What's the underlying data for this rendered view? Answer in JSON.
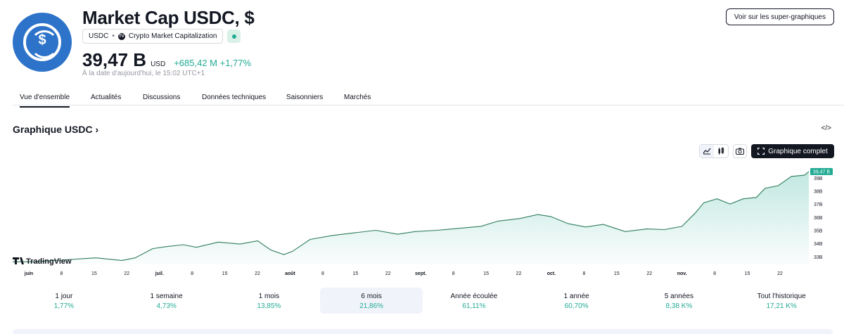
{
  "header": {
    "title": "Market Cap USDC, $",
    "symbol": "USDC",
    "source": "Crypto Market Capitalization",
    "price": "39,47 B",
    "currency": "USD",
    "change": "+685,42 M +1,77%",
    "as_of": "À la date d'aujourd'hui, le 15:02 UTC+1",
    "super_button": "Voir sur les super-graphiques",
    "logo_symbol": "$"
  },
  "tabs": [
    {
      "label": "Vue d'ensemble",
      "active": true
    },
    {
      "label": "Actualités"
    },
    {
      "label": "Discussions"
    },
    {
      "label": "Données techniques"
    },
    {
      "label": "Saisonniers"
    },
    {
      "label": "Marchés"
    }
  ],
  "section": {
    "title": "Graphique USDC",
    "chevron": "›",
    "embed_icon": "code-icon"
  },
  "toolbar": {
    "full_chart": "Graphique complet"
  },
  "watermark": "TradingView",
  "colors": {
    "accent": "#22ab94",
    "line": "#2e7d5a",
    "brand": "#2d73c9"
  },
  "chart_data": {
    "type": "area",
    "y_unit": "B USD",
    "ylim": [
      32.4,
      39.9
    ],
    "yticks": [
      "33B",
      "34B",
      "35B",
      "36B",
      "37B",
      "38B",
      "39B"
    ],
    "last_label": "39,47 B",
    "xticks": [
      "juin",
      "8",
      "15",
      "22",
      "juil.",
      "8",
      "15",
      "22",
      "août",
      "8",
      "15",
      "22",
      "sept.",
      "8",
      "15",
      "22",
      "oct.",
      "8",
      "15",
      "22",
      "nov.",
      "8",
      "15",
      "22"
    ],
    "x": [
      "2024-06-03",
      "2024-06-08",
      "2024-06-15",
      "2024-06-22",
      "2024-06-28",
      "2024-07-01",
      "2024-07-05",
      "2024-07-08",
      "2024-07-12",
      "2024-07-15",
      "2024-07-20",
      "2024-07-25",
      "2024-07-29",
      "2024-08-01",
      "2024-08-04",
      "2024-08-06",
      "2024-08-10",
      "2024-08-15",
      "2024-08-20",
      "2024-08-25",
      "2024-08-30",
      "2024-09-03",
      "2024-09-08",
      "2024-09-13",
      "2024-09-18",
      "2024-09-22",
      "2024-09-27",
      "2024-10-01",
      "2024-10-04",
      "2024-10-08",
      "2024-10-12",
      "2024-10-16",
      "2024-10-21",
      "2024-10-26",
      "2024-10-30",
      "2024-11-03",
      "2024-11-06",
      "2024-11-08",
      "2024-11-11",
      "2024-11-14",
      "2024-11-17",
      "2024-11-20",
      "2024-11-22",
      "2024-11-25",
      "2024-11-28",
      "2024-12-01",
      "2024-12-02"
    ],
    "values": [
      32.6,
      32.6,
      32.75,
      32.9,
      32.7,
      32.9,
      33.6,
      33.75,
      33.9,
      33.7,
      34.1,
      33.95,
      34.2,
      33.5,
      33.15,
      33.4,
      34.3,
      34.6,
      34.8,
      35.0,
      34.7,
      34.9,
      35.0,
      35.15,
      35.3,
      35.7,
      35.9,
      36.2,
      36.05,
      35.5,
      35.25,
      35.45,
      34.9,
      35.1,
      35.05,
      35.3,
      36.3,
      37.1,
      37.4,
      37.0,
      37.4,
      37.5,
      38.2,
      38.4,
      39.1,
      39.2,
      39.47
    ]
  },
  "periods": [
    {
      "label": "1 jour",
      "value": "1,77%"
    },
    {
      "label": "1 semaine",
      "value": "4,73%"
    },
    {
      "label": "1 mois",
      "value": "13,85%"
    },
    {
      "label": "6 mois",
      "value": "21,86%",
      "selected": true
    },
    {
      "label": "Année écoulée",
      "value": "61,11%"
    },
    {
      "label": "1 année",
      "value": "60,70%"
    },
    {
      "label": "5 années",
      "value": "8,38 K%"
    },
    {
      "label": "Tout l'historique",
      "value": "17,21 K%"
    }
  ]
}
